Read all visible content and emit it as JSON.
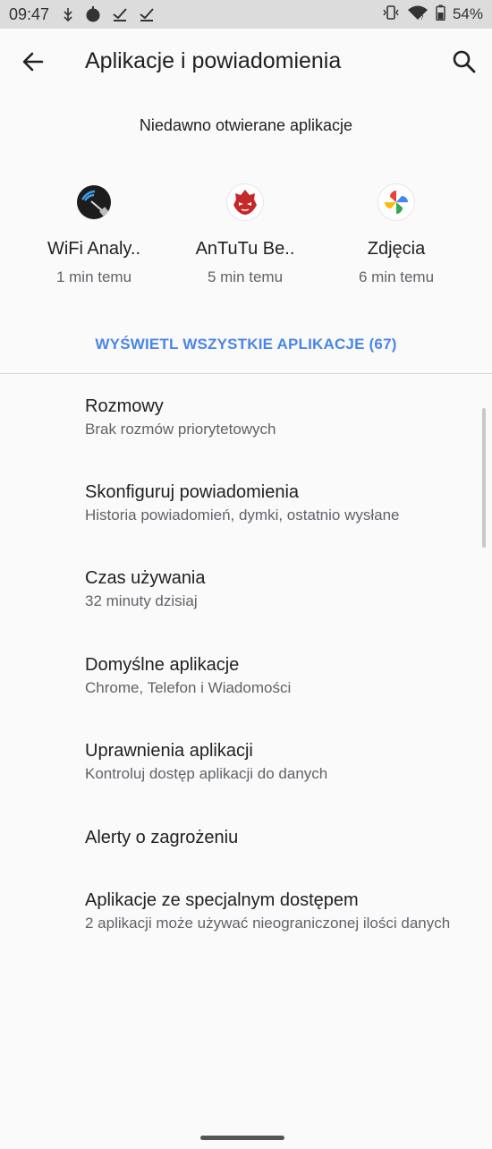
{
  "status_bar": {
    "time": "09:47",
    "battery": "54%",
    "icons": [
      "usb-debug-icon",
      "recording-icon",
      "check-icon",
      "check-icon",
      "vibrate-icon",
      "wifi-icon",
      "battery-icon"
    ]
  },
  "app_bar": {
    "title": "Aplikacje i powiadomienia"
  },
  "recent": {
    "title": "Niedawno otwierane aplikacje",
    "apps": [
      {
        "name": "WiFi Analy..",
        "time": "1 min temu",
        "icon": "wifi-analyzer-icon"
      },
      {
        "name": "AnTuTu Be..",
        "time": "5 min temu",
        "icon": "antutu-icon"
      },
      {
        "name": "Zdjęcia",
        "time": "6 min temu",
        "icon": "photos-icon"
      }
    ],
    "view_all": "WYŚWIETL WSZYSTKIE APLIKACJE (67)"
  },
  "settings": [
    {
      "title": "Rozmowy",
      "subtitle": "Brak rozmów priorytetowych"
    },
    {
      "title": "Skonfiguruj powiadomienia",
      "subtitle": "Historia powiadomień, dymki, ostatnio wysłane"
    },
    {
      "title": "Czas używania",
      "subtitle": "32 minuty dzisiaj"
    },
    {
      "title": "Domyślne aplikacje",
      "subtitle": "Chrome, Telefon i Wiadomości"
    },
    {
      "title": "Uprawnienia aplikacji",
      "subtitle": "Kontroluj dostęp aplikacji do danych"
    },
    {
      "title": "Alerty o zagrożeniu",
      "subtitle": ""
    },
    {
      "title": "Aplikacje ze specjalnym dostępem",
      "subtitle": "2 aplikacji może używać nieograniczonej ilości danych"
    }
  ],
  "colors": {
    "accent": "#4a86e8",
    "background": "#fafafa",
    "status_bar": "#dcdcdc"
  }
}
